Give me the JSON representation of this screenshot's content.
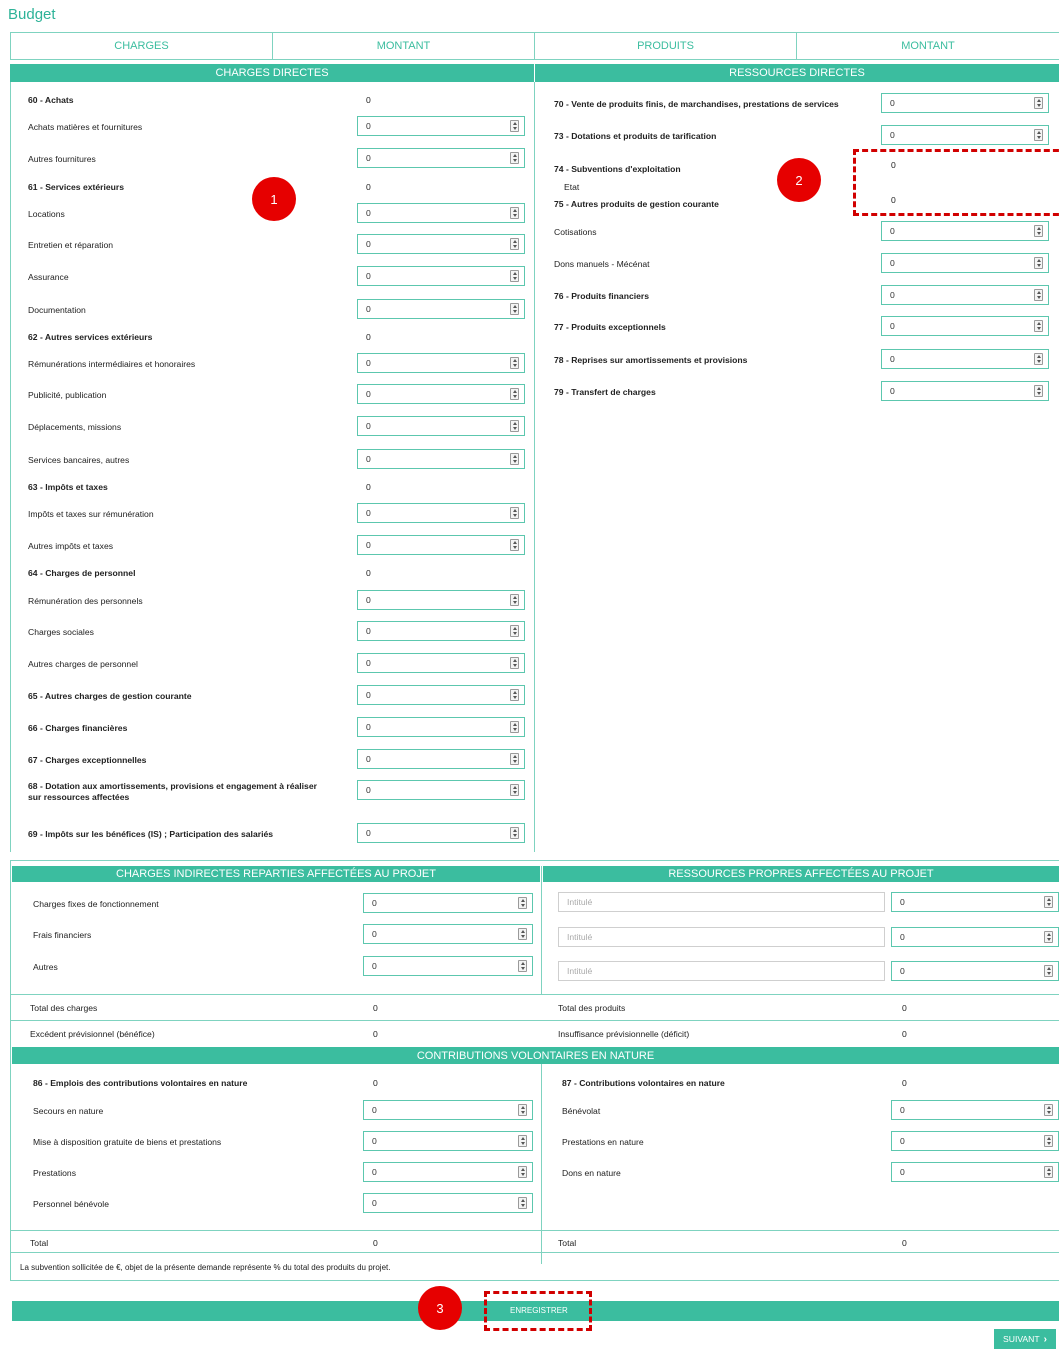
{
  "page": {
    "title": "Budget"
  },
  "header": {
    "charges": "CHARGES",
    "montant1": "MONTANT",
    "produits": "PRODUITS",
    "montant2": "MONTANT"
  },
  "sections": {
    "charges_directes": "CHARGES DIRECTES",
    "ressources_directes": "RESSOURCES DIRECTES",
    "charges_indirectes": "CHARGES INDIRECTES REPARTIES AFFECTÉES AU PROJET",
    "ressources_propres": "RESSOURCES PROPRES AFFECTÉES AU PROJET",
    "contributions": "CONTRIBUTIONS VOLONTAIRES EN NATURE"
  },
  "charges": [
    {
      "label": "60 - Achats",
      "bold": true,
      "value": "0",
      "input": false
    },
    {
      "label": "Achats matières et fournitures",
      "value": "0",
      "input": true
    },
    {
      "label": "Autres fournitures",
      "value": "0",
      "input": true
    },
    {
      "label": "61 - Services extérieurs",
      "bold": true,
      "value": "0",
      "input": false
    },
    {
      "label": "Locations",
      "value": "0",
      "input": true
    },
    {
      "label": "Entretien et réparation",
      "value": "0",
      "input": true
    },
    {
      "label": "Assurance",
      "value": "0",
      "input": true
    },
    {
      "label": "Documentation",
      "value": "0",
      "input": true
    },
    {
      "label": "62 - Autres services extérieurs",
      "bold": true,
      "value": "0",
      "input": false
    },
    {
      "label": "Rémunérations intermédiaires et honoraires",
      "value": "0",
      "input": true
    },
    {
      "label": "Publicité, publication",
      "value": "0",
      "input": true
    },
    {
      "label": "Déplacements, missions",
      "value": "0",
      "input": true
    },
    {
      "label": "Services bancaires, autres",
      "value": "0",
      "input": true
    },
    {
      "label": "63 - Impôts et taxes",
      "bold": true,
      "value": "0",
      "input": false
    },
    {
      "label": "Impôts et taxes sur rémunération",
      "value": "0",
      "input": true
    },
    {
      "label": "Autres impôts et taxes",
      "value": "0",
      "input": true
    },
    {
      "label": "64 - Charges de personnel",
      "bold": true,
      "value": "0",
      "input": false
    },
    {
      "label": "Rémunération des personnels",
      "value": "0",
      "input": true
    },
    {
      "label": "Charges sociales",
      "value": "0",
      "input": true
    },
    {
      "label": "Autres charges de personnel",
      "value": "0",
      "input": true
    },
    {
      "label": "65 - Autres charges de gestion courante",
      "bold": true,
      "value": "0",
      "input": true
    },
    {
      "label": "66 - Charges financières",
      "bold": true,
      "value": "0",
      "input": true
    },
    {
      "label": "67 - Charges exceptionnelles",
      "bold": true,
      "value": "0",
      "input": true
    },
    {
      "label": "68 - Dotation aux amortissements, provisions et engagement à réaliser sur ressources affectées",
      "bold": true,
      "value": "0",
      "input": true
    },
    {
      "label": "69 - Impôts sur les bénéfices (IS) ; Participation des salariés",
      "bold": true,
      "value": "0",
      "input": true
    }
  ],
  "produits": [
    {
      "label": "70 - Vente de produits finis, de marchandises, prestations de services",
      "bold": true,
      "value": "0",
      "input": true
    },
    {
      "label": "73 - Dotations et produits de tarification",
      "bold": true,
      "value": "0",
      "input": true
    },
    {
      "label": "74 - Subventions d'exploitation",
      "bold": true,
      "value": "0",
      "input": false
    },
    {
      "label": "Etat",
      "value": "",
      "input": false
    },
    {
      "label": "75 - Autres produits de gestion courante",
      "bold": true,
      "value": "0",
      "input": false
    },
    {
      "label": "Cotisations",
      "value": "0",
      "input": true
    },
    {
      "label": "Dons manuels - Mécénat",
      "value": "0",
      "input": true
    },
    {
      "label": "76 - Produits financiers",
      "bold": true,
      "value": "0",
      "input": true
    },
    {
      "label": "77 - Produits exceptionnels",
      "bold": true,
      "value": "0",
      "input": true
    },
    {
      "label": "78 - Reprises sur amortissements et provisions",
      "bold": true,
      "value": "0",
      "input": true
    },
    {
      "label": "79 - Transfert de charges",
      "bold": true,
      "value": "0",
      "input": true
    }
  ],
  "indirect": [
    {
      "label": "Charges fixes de fonctionnement",
      "value": "0"
    },
    {
      "label": "Frais financiers",
      "value": "0"
    },
    {
      "label": "Autres",
      "value": "0"
    }
  ],
  "propres": [
    {
      "placeholder": "Intitulé",
      "value": "0"
    },
    {
      "placeholder": "Intitulé",
      "value": "0"
    },
    {
      "placeholder": "Intitulé",
      "value": "0"
    }
  ],
  "totals": {
    "total_charges_label": "Total des charges",
    "total_charges": "0",
    "excedent_label": "Excédent prévisionnel (bénéfice)",
    "excedent": "0",
    "total_produits_label": "Total des produits",
    "total_produits": "0",
    "insuffisance_label": "Insuffisance prévisionnelle (déficit)",
    "insuffisance": "0"
  },
  "contrib_left": {
    "title": "86 - Emplois des contributions volontaires en nature",
    "value": "0",
    "items": [
      {
        "label": "Secours en nature",
        "value": "0"
      },
      {
        "label": "Mise à disposition gratuite de biens et prestations",
        "value": "0"
      },
      {
        "label": "Prestations",
        "value": "0"
      },
      {
        "label": "Personnel bénévole",
        "value": "0"
      }
    ],
    "total_label": "Total",
    "total": "0"
  },
  "contrib_right": {
    "title": "87 - Contributions volontaires en nature",
    "value": "0",
    "items": [
      {
        "label": "Bénévolat",
        "value": "0"
      },
      {
        "label": "Prestations en nature",
        "value": "0"
      },
      {
        "label": "Dons en nature",
        "value": "0"
      }
    ],
    "total_label": "Total",
    "total": "0"
  },
  "footer_note": "La subvention sollicitée de €, objet de la présente demande représente % du total des produits du projet.",
  "buttons": {
    "save": "ENREGISTRER",
    "next": "SUIVANT",
    "next_icon": "chevron-right-icon"
  },
  "annotations": [
    "1",
    "2",
    "3"
  ],
  "colors": {
    "accent": "#3bbd9f",
    "annotation": "#e60000"
  }
}
